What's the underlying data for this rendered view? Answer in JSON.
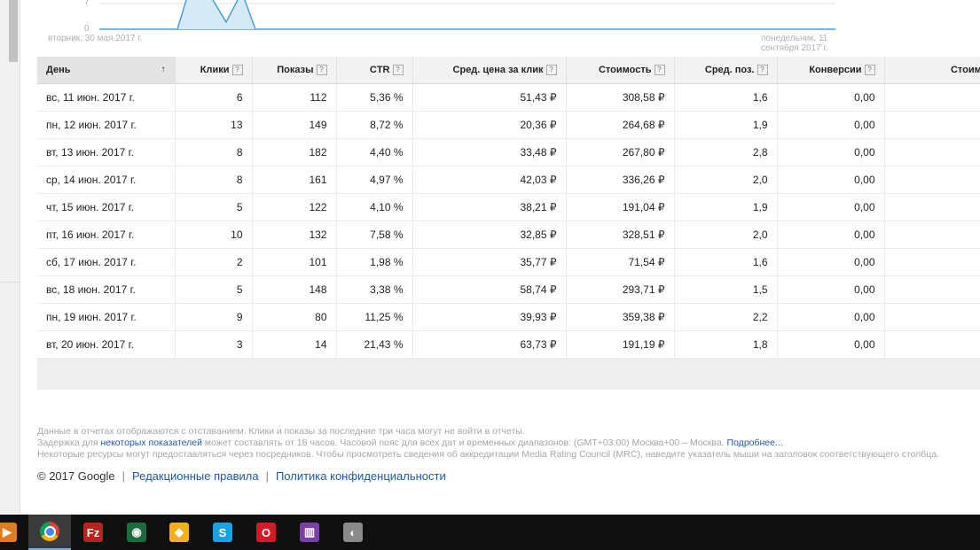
{
  "chart": {
    "start_date": "вторник, 30 мая 2017 г.",
    "end_date": "понедельник, 11 сентября 2017 г.",
    "y_ticks": [
      "7",
      "0"
    ]
  },
  "table": {
    "headers": [
      {
        "label": "День",
        "help": false,
        "sort": "↑"
      },
      {
        "label": "Клики",
        "help": true
      },
      {
        "label": "Показы",
        "help": true
      },
      {
        "label": "CTR",
        "help": true
      },
      {
        "label": "Сред. цена за клик",
        "help": true
      },
      {
        "label": "Стоимость",
        "help": true
      },
      {
        "label": "Сред. поз.",
        "help": true
      },
      {
        "label": "Конверсии",
        "help": true
      },
      {
        "label": "Стоимость",
        "help": false
      }
    ],
    "rows": [
      [
        "вс, 11 июн. 2017 г.",
        "6",
        "112",
        "5,36 %",
        "51,43 ₽",
        "308,58 ₽",
        "1,6",
        "0,00",
        ""
      ],
      [
        "пн, 12 июн. 2017 г.",
        "13",
        "149",
        "8,72 %",
        "20,36 ₽",
        "264,68 ₽",
        "1,9",
        "0,00",
        ""
      ],
      [
        "вт, 13 июн. 2017 г.",
        "8",
        "182",
        "4,40 %",
        "33,48 ₽",
        "267,80 ₽",
        "2,8",
        "0,00",
        ""
      ],
      [
        "ср, 14 июн. 2017 г.",
        "8",
        "161",
        "4,97 %",
        "42,03 ₽",
        "336,26 ₽",
        "2,0",
        "0,00",
        ""
      ],
      [
        "чт, 15 июн. 2017 г.",
        "5",
        "122",
        "4,10 %",
        "38,21 ₽",
        "191,04 ₽",
        "1,9",
        "0,00",
        ""
      ],
      [
        "пт, 16 июн. 2017 г.",
        "10",
        "132",
        "7,58 %",
        "32,85 ₽",
        "328,51 ₽",
        "2,0",
        "0,00",
        ""
      ],
      [
        "сб, 17 июн. 2017 г.",
        "2",
        "101",
        "1,98 %",
        "35,77 ₽",
        "71,54 ₽",
        "1,6",
        "0,00",
        ""
      ],
      [
        "вс, 18 июн. 2017 г.",
        "5",
        "148",
        "3,38 %",
        "58,74 ₽",
        "293,71 ₽",
        "1,5",
        "0,00",
        ""
      ],
      [
        "пн, 19 июн. 2017 г.",
        "9",
        "80",
        "11,25 %",
        "39,93 ₽",
        "359,38 ₽",
        "2,2",
        "0,00",
        ""
      ],
      [
        "вт, 20 июн. 2017 г.",
        "3",
        "14",
        "21,43 %",
        "63,73 ₽",
        "191,19 ₽",
        "1,8",
        "0,00",
        ""
      ]
    ]
  },
  "notes": {
    "line1": "Данные в отчетах отображаются с отставанием. Клики и показы за последние три часа могут не войти в отчеты.",
    "line2_pre": "Задержка для ",
    "line2_link": "некоторых показателей",
    "line2_mid": " может составлять от 18 часов. Часовой пояс для всех дат и временных диапазонов: (GMT+03:00) Москва+00 – Москва. ",
    "line2_more": "Подробнее...",
    "line3": "Некоторые ресурсы могут предоставляться через посредников. Чтобы просмотреть сведения об аккредитации Media Rating Council (MRC), наведите указатель мыши на заголовок соответствующего столбца."
  },
  "footer": {
    "copyright": "© 2017 Google",
    "sep": "|",
    "link1": "Редакционные правила",
    "link2": "Политика конфиденциальности"
  },
  "taskbar": {
    "apps": [
      {
        "name": "media-player",
        "glyph": "▶",
        "color": "#e07b1f"
      },
      {
        "name": "chrome",
        "glyph": "",
        "color": "#2d7d46"
      },
      {
        "name": "filezilla",
        "glyph": "Fz",
        "color": "#b6241c"
      },
      {
        "name": "app-green",
        "glyph": "◉",
        "color": "#1c6b3a"
      },
      {
        "name": "app-colorful",
        "glyph": "◆",
        "color": "#f2b01e"
      },
      {
        "name": "skype",
        "glyph": "S",
        "color": "#1da1e2"
      },
      {
        "name": "opera",
        "glyph": "O",
        "color": "#d41a24"
      },
      {
        "name": "app-purple",
        "glyph": "▥",
        "color": "#7b3fa8"
      },
      {
        "name": "app-gray",
        "glyph": "◐",
        "color": "#8a8a8a"
      }
    ]
  }
}
